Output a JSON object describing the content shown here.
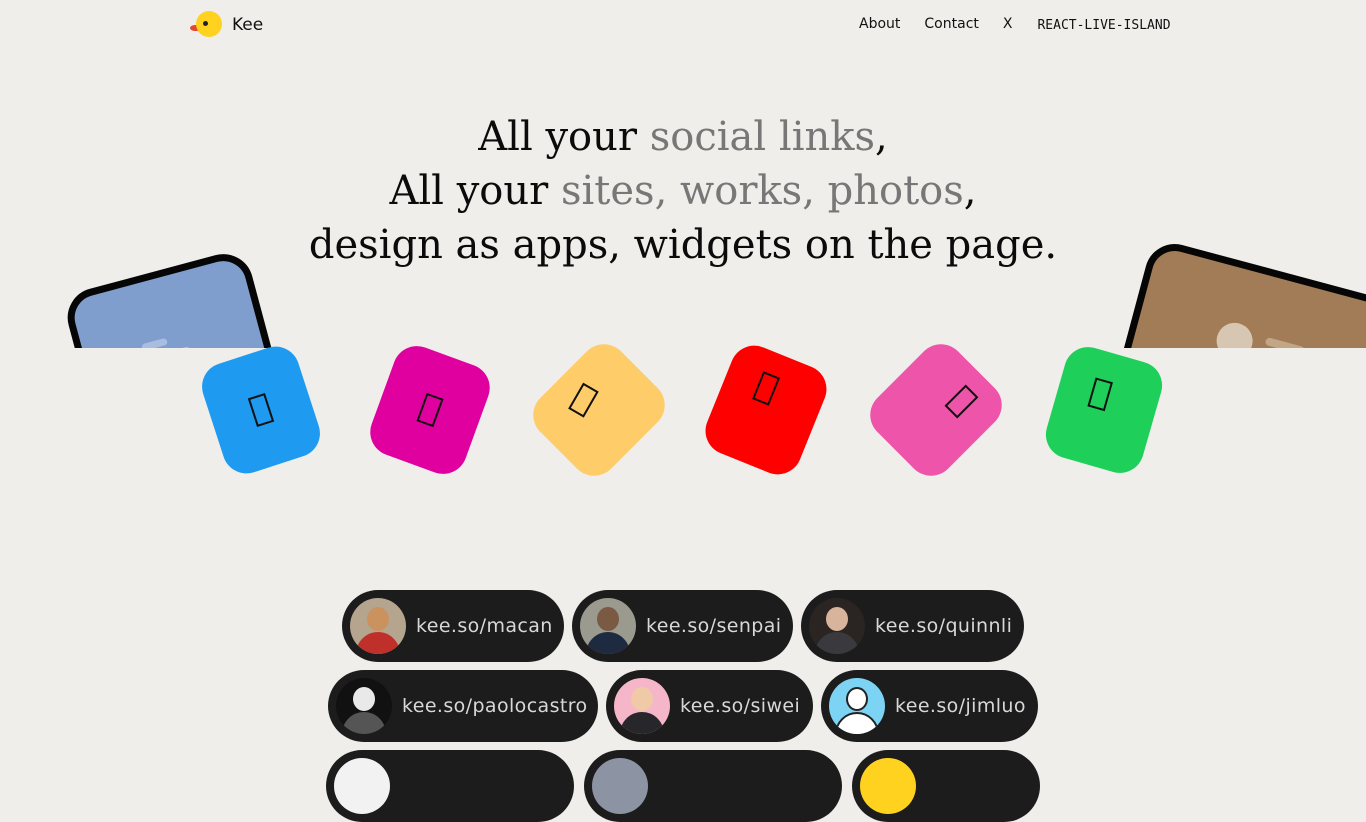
{
  "brand": {
    "name": "Kee",
    "logo_icon": "duck-logo-icon"
  },
  "nav": {
    "about": "About",
    "contact": "Contact",
    "x": "X",
    "island": "REACT-LIVE-ISLAND"
  },
  "hero": {
    "line1_a": "All your ",
    "line1_b": "social links",
    "line1_c": ",",
    "line2_a": "All your ",
    "line2_b": "sites, works, photos",
    "line2_c": ",",
    "line3": "design as apps, widgets on the page."
  },
  "apps": [
    {
      "name": "blue-app-icon",
      "color": "#1e9bf0"
    },
    {
      "name": "magenta-app-icon",
      "color": "#e0009f"
    },
    {
      "name": "yellow-app-icon",
      "color": "#ffcc6a"
    },
    {
      "name": "red-app-icon",
      "color": "#ff0000"
    },
    {
      "name": "pink-app-icon",
      "color": "#ee55aa"
    },
    {
      "name": "green-app-icon",
      "color": "#1ecf5a"
    }
  ],
  "profiles": [
    {
      "handle": "kee.so/macan"
    },
    {
      "handle": "kee.so/senpai"
    },
    {
      "handle": "kee.so/quinnli"
    },
    {
      "handle": "kee.so/paolocastro"
    },
    {
      "handle": "kee.so/siwei"
    },
    {
      "handle": "kee.so/jimluo"
    }
  ]
}
